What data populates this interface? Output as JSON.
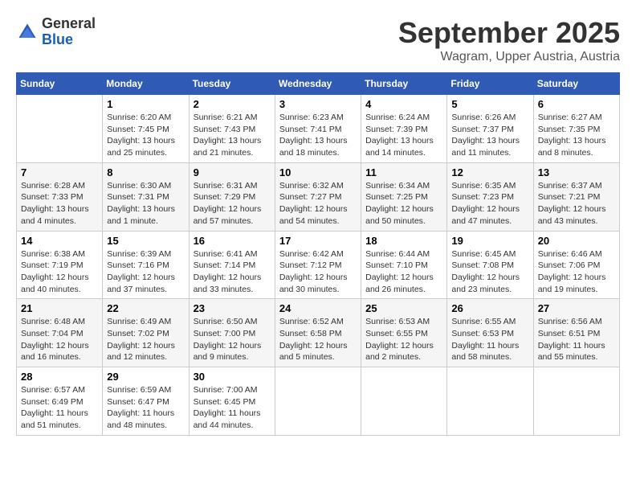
{
  "header": {
    "logo": {
      "general": "General",
      "blue": "Blue"
    },
    "title": "September 2025",
    "location": "Wagram, Upper Austria, Austria"
  },
  "calendar": {
    "days_of_week": [
      "Sunday",
      "Monday",
      "Tuesday",
      "Wednesday",
      "Thursday",
      "Friday",
      "Saturday"
    ],
    "weeks": [
      [
        {
          "day": "",
          "info": ""
        },
        {
          "day": "1",
          "info": "Sunrise: 6:20 AM\nSunset: 7:45 PM\nDaylight: 13 hours\nand 25 minutes."
        },
        {
          "day": "2",
          "info": "Sunrise: 6:21 AM\nSunset: 7:43 PM\nDaylight: 13 hours\nand 21 minutes."
        },
        {
          "day": "3",
          "info": "Sunrise: 6:23 AM\nSunset: 7:41 PM\nDaylight: 13 hours\nand 18 minutes."
        },
        {
          "day": "4",
          "info": "Sunrise: 6:24 AM\nSunset: 7:39 PM\nDaylight: 13 hours\nand 14 minutes."
        },
        {
          "day": "5",
          "info": "Sunrise: 6:26 AM\nSunset: 7:37 PM\nDaylight: 13 hours\nand 11 minutes."
        },
        {
          "day": "6",
          "info": "Sunrise: 6:27 AM\nSunset: 7:35 PM\nDaylight: 13 hours\nand 8 minutes."
        }
      ],
      [
        {
          "day": "7",
          "info": "Sunrise: 6:28 AM\nSunset: 7:33 PM\nDaylight: 13 hours\nand 4 minutes."
        },
        {
          "day": "8",
          "info": "Sunrise: 6:30 AM\nSunset: 7:31 PM\nDaylight: 13 hours\nand 1 minute."
        },
        {
          "day": "9",
          "info": "Sunrise: 6:31 AM\nSunset: 7:29 PM\nDaylight: 12 hours\nand 57 minutes."
        },
        {
          "day": "10",
          "info": "Sunrise: 6:32 AM\nSunset: 7:27 PM\nDaylight: 12 hours\nand 54 minutes."
        },
        {
          "day": "11",
          "info": "Sunrise: 6:34 AM\nSunset: 7:25 PM\nDaylight: 12 hours\nand 50 minutes."
        },
        {
          "day": "12",
          "info": "Sunrise: 6:35 AM\nSunset: 7:23 PM\nDaylight: 12 hours\nand 47 minutes."
        },
        {
          "day": "13",
          "info": "Sunrise: 6:37 AM\nSunset: 7:21 PM\nDaylight: 12 hours\nand 43 minutes."
        }
      ],
      [
        {
          "day": "14",
          "info": "Sunrise: 6:38 AM\nSunset: 7:19 PM\nDaylight: 12 hours\nand 40 minutes."
        },
        {
          "day": "15",
          "info": "Sunrise: 6:39 AM\nSunset: 7:16 PM\nDaylight: 12 hours\nand 37 minutes."
        },
        {
          "day": "16",
          "info": "Sunrise: 6:41 AM\nSunset: 7:14 PM\nDaylight: 12 hours\nand 33 minutes."
        },
        {
          "day": "17",
          "info": "Sunrise: 6:42 AM\nSunset: 7:12 PM\nDaylight: 12 hours\nand 30 minutes."
        },
        {
          "day": "18",
          "info": "Sunrise: 6:44 AM\nSunset: 7:10 PM\nDaylight: 12 hours\nand 26 minutes."
        },
        {
          "day": "19",
          "info": "Sunrise: 6:45 AM\nSunset: 7:08 PM\nDaylight: 12 hours\nand 23 minutes."
        },
        {
          "day": "20",
          "info": "Sunrise: 6:46 AM\nSunset: 7:06 PM\nDaylight: 12 hours\nand 19 minutes."
        }
      ],
      [
        {
          "day": "21",
          "info": "Sunrise: 6:48 AM\nSunset: 7:04 PM\nDaylight: 12 hours\nand 16 minutes."
        },
        {
          "day": "22",
          "info": "Sunrise: 6:49 AM\nSunset: 7:02 PM\nDaylight: 12 hours\nand 12 minutes."
        },
        {
          "day": "23",
          "info": "Sunrise: 6:50 AM\nSunset: 7:00 PM\nDaylight: 12 hours\nand 9 minutes."
        },
        {
          "day": "24",
          "info": "Sunrise: 6:52 AM\nSunset: 6:58 PM\nDaylight: 12 hours\nand 5 minutes."
        },
        {
          "day": "25",
          "info": "Sunrise: 6:53 AM\nSunset: 6:55 PM\nDaylight: 12 hours\nand 2 minutes."
        },
        {
          "day": "26",
          "info": "Sunrise: 6:55 AM\nSunset: 6:53 PM\nDaylight: 11 hours\nand 58 minutes."
        },
        {
          "day": "27",
          "info": "Sunrise: 6:56 AM\nSunset: 6:51 PM\nDaylight: 11 hours\nand 55 minutes."
        }
      ],
      [
        {
          "day": "28",
          "info": "Sunrise: 6:57 AM\nSunset: 6:49 PM\nDaylight: 11 hours\nand 51 minutes."
        },
        {
          "day": "29",
          "info": "Sunrise: 6:59 AM\nSunset: 6:47 PM\nDaylight: 11 hours\nand 48 minutes."
        },
        {
          "day": "30",
          "info": "Sunrise: 7:00 AM\nSunset: 6:45 PM\nDaylight: 11 hours\nand 44 minutes."
        },
        {
          "day": "",
          "info": ""
        },
        {
          "day": "",
          "info": ""
        },
        {
          "day": "",
          "info": ""
        },
        {
          "day": "",
          "info": ""
        }
      ]
    ]
  }
}
